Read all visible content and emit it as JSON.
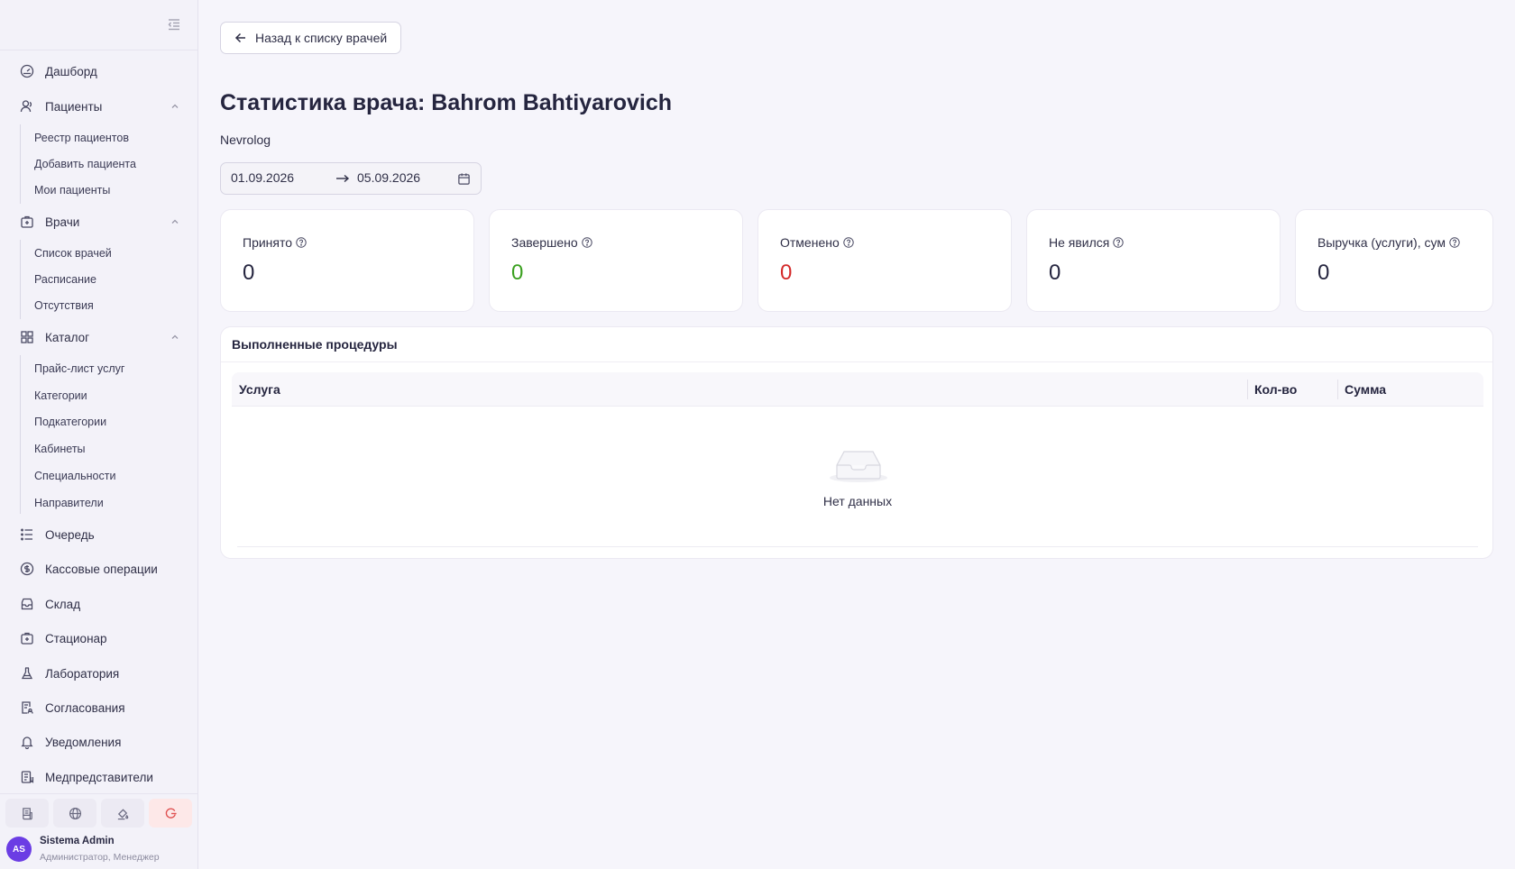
{
  "sidebar": {
    "nav": [
      {
        "label": "Дашборд",
        "icon": "dashboard-icon"
      },
      {
        "label": "Пациенты",
        "icon": "patients-icon",
        "sub": [
          "Реестр пациентов",
          "Добавить пациента",
          "Мои пациенты"
        ]
      },
      {
        "label": "Врачи",
        "icon": "doctors-icon",
        "sub": [
          "Список врачей",
          "Расписание",
          "Отсутствия"
        ]
      },
      {
        "label": "Каталог",
        "icon": "catalog-icon",
        "sub": [
          "Прайс-лист услуг",
          "Категории",
          "Подкатегории",
          "Кабинеты",
          "Специальности",
          "Направители"
        ]
      },
      {
        "label": "Очередь",
        "icon": "queue-icon"
      },
      {
        "label": "Кассовые операции",
        "icon": "cash-icon"
      },
      {
        "label": "Склад",
        "icon": "warehouse-icon"
      },
      {
        "label": "Стационар",
        "icon": "hospital-icon"
      },
      {
        "label": "Лаборатория",
        "icon": "flask-icon"
      },
      {
        "label": "Согласования",
        "icon": "approval-icon"
      },
      {
        "label": "Уведомления",
        "icon": "bell-icon"
      },
      {
        "label": "Медпредставители",
        "icon": "reps-icon"
      }
    ],
    "user": {
      "initials": "AS",
      "name": "Sistema Admin",
      "role": "Администратор, Менеджер"
    }
  },
  "main": {
    "back_label": "Назад к списку врачей",
    "title": "Статистика врача: Bahrom Bahtiyarovich",
    "specialty": "Nevrolog",
    "date_from": "01.09.2026",
    "date_to": "05.09.2026",
    "stats": [
      {
        "label": "Принято",
        "value": "0",
        "color": "#25253f"
      },
      {
        "label": "Завершено",
        "value": "0",
        "color": "#3aa01f"
      },
      {
        "label": "Отменено",
        "value": "0",
        "color": "#d42a2a"
      },
      {
        "label": "Не явился",
        "value": "0",
        "color": "#25253f"
      },
      {
        "label": "Выручка (услуги), сум",
        "value": "0",
        "color": "#25253f"
      }
    ],
    "procedures": {
      "title": "Выполненные процедуры",
      "columns": [
        "Услуга",
        "Кол-во",
        "Сумма"
      ],
      "empty_text": "Нет данных"
    }
  }
}
